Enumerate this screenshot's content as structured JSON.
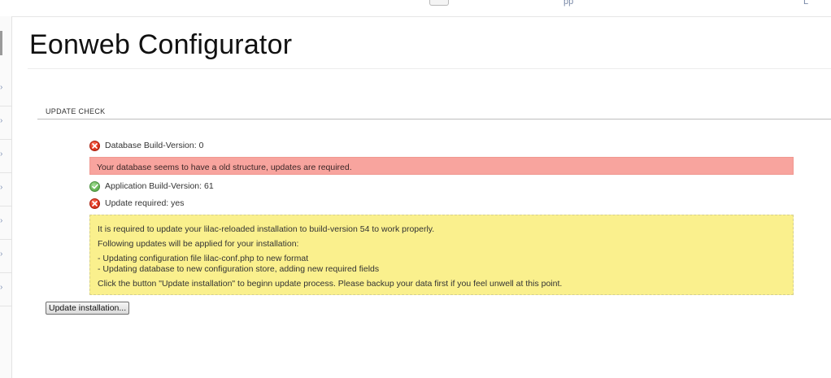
{
  "header": {
    "title": "Eonweb Configurator"
  },
  "update_check": {
    "section_title": "UPDATE CHECK",
    "database_build": {
      "label": "Database Build-Version: 0",
      "status": "error"
    },
    "database_warning": "Your database seems to have a old structure, updates are required.",
    "application_build": {
      "label": "Application Build-Version: 61",
      "status": "ok"
    },
    "update_required": {
      "label": "Update required: yes",
      "status": "error"
    },
    "notice": {
      "line_1": "It is required to update your lilac-reloaded installation to build-version 54 to work properly.",
      "line_2": "Following updates will be applied for your installation:",
      "line_3": "- Updating configuration file lilac-conf.php to new format",
      "line_4": "- Updating database to new configuration store, adding new required fields",
      "line_5": "Click the button \"Update installation\" to beginn update process. Please backup your data first if you feel unwell at this point."
    },
    "button_label": "Update installation..."
  },
  "colors": {
    "error_background": "#f8a49e",
    "notice_background": "#faf08d",
    "error_icon": "#e2361f",
    "ok_icon": "#6bb85b"
  },
  "icons": {
    "error": "error-x-icon",
    "ok": "success-check-icon",
    "rail": "chevron-right-icon"
  }
}
